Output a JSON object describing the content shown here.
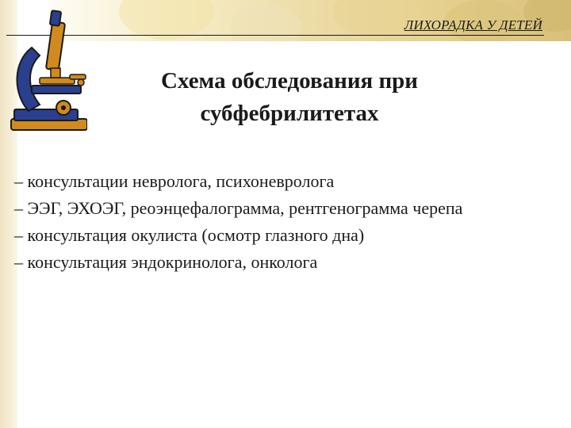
{
  "header": {
    "title": "ЛИХОРАДКА У ДЕТЕЙ"
  },
  "decor": {
    "banner_colors": [
      "#f6ecc8",
      "#e6d08f",
      "#d9c07a"
    ],
    "microscope_colors": {
      "brass": "#d08a1e",
      "body": "#2b3f8f",
      "dark": "#1a1a1a"
    },
    "icon": "microscope-icon"
  },
  "slide": {
    "title_line1": "Схема обследования при",
    "title_line2": "субфебрилитетах",
    "items": [
      "– консультации невролога, психоневролога",
      "– ЭЭГ, ЭХОЭГ, реоэнцефалограмма, рентгенограмма черепа",
      "– консультация окулиста (осмотр глазного дна)",
      "– консультация эндокринолога, онколога"
    ]
  }
}
